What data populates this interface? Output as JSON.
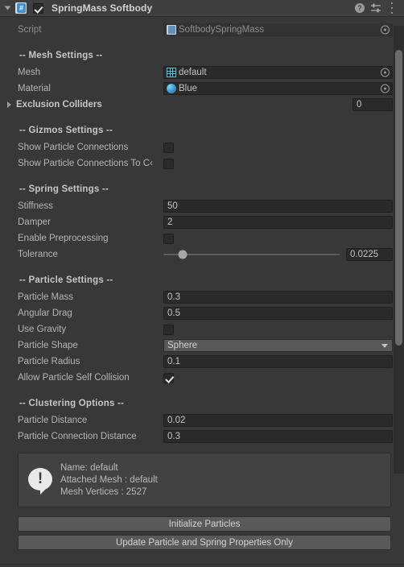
{
  "header": {
    "title": "SpringMass Softbody",
    "enabled_checkbox": true,
    "foldout_expanded": true,
    "icons": [
      "script-csharp-icon",
      "help-icon",
      "preset-icon",
      "kebab-menu-icon"
    ]
  },
  "script_row": {
    "label": "Script",
    "value": "SoftbodySpringMass",
    "disabled": true
  },
  "sections": {
    "mesh": {
      "title": "-- Mesh Settings --",
      "mesh": {
        "label": "Mesh",
        "value": "default"
      },
      "material": {
        "label": "Material",
        "value": "Blue"
      },
      "exclusion_colliders": {
        "label": "Exclusion Colliders",
        "count": "0"
      }
    },
    "gizmos": {
      "title": "-- Gizmos Settings --",
      "show_particle_connections": {
        "label": "Show Particle Connections",
        "checked": false
      },
      "show_particle_connections_to_c": {
        "label": "Show Particle Connections To C‹",
        "checked": false
      }
    },
    "spring": {
      "title": "-- Spring Settings --",
      "stiffness": {
        "label": "Stiffness",
        "value": "50"
      },
      "damper": {
        "label": "Damper",
        "value": "2"
      },
      "enable_preprocessing": {
        "label": "Enable Preprocessing",
        "checked": false
      },
      "tolerance": {
        "label": "Tolerance",
        "value": "0.0225",
        "slider_percent": 11
      }
    },
    "particle": {
      "title": "-- Particle Settings --",
      "particle_mass": {
        "label": "Particle Mass",
        "value": "0.3"
      },
      "angular_drag": {
        "label": "Angular Drag",
        "value": "0.5"
      },
      "use_gravity": {
        "label": "Use Gravity",
        "checked": false
      },
      "particle_shape": {
        "label": "Particle Shape",
        "value": "Sphere"
      },
      "particle_radius": {
        "label": "Particle Radius",
        "value": "0.1"
      },
      "allow_particle_self_collision": {
        "label": "Allow Particle Self Collision",
        "checked": true
      }
    },
    "clustering": {
      "title": "-- Clustering Options --",
      "particle_distance": {
        "label": "Particle Distance",
        "value": "0.02"
      },
      "particle_connection_distance": {
        "label": "Particle Connection Distance",
        "value": "0.3"
      }
    }
  },
  "info_box": {
    "icon": "info-bubble-icon",
    "line1": "Name: default",
    "line2": "Attached Mesh : default",
    "line3": "Mesh Vertices : 2527"
  },
  "buttons": {
    "initialize": "Initialize Particles",
    "update_only": "Update Particle and Spring Properties Only"
  },
  "colors": {
    "background": "#383838",
    "header_bg": "#3f3f3f",
    "field_bg": "#2a2a2a",
    "button_bg": "#595959",
    "accent_blue": "#3f8fd0",
    "mesh_icon": "#4ec9e0"
  }
}
